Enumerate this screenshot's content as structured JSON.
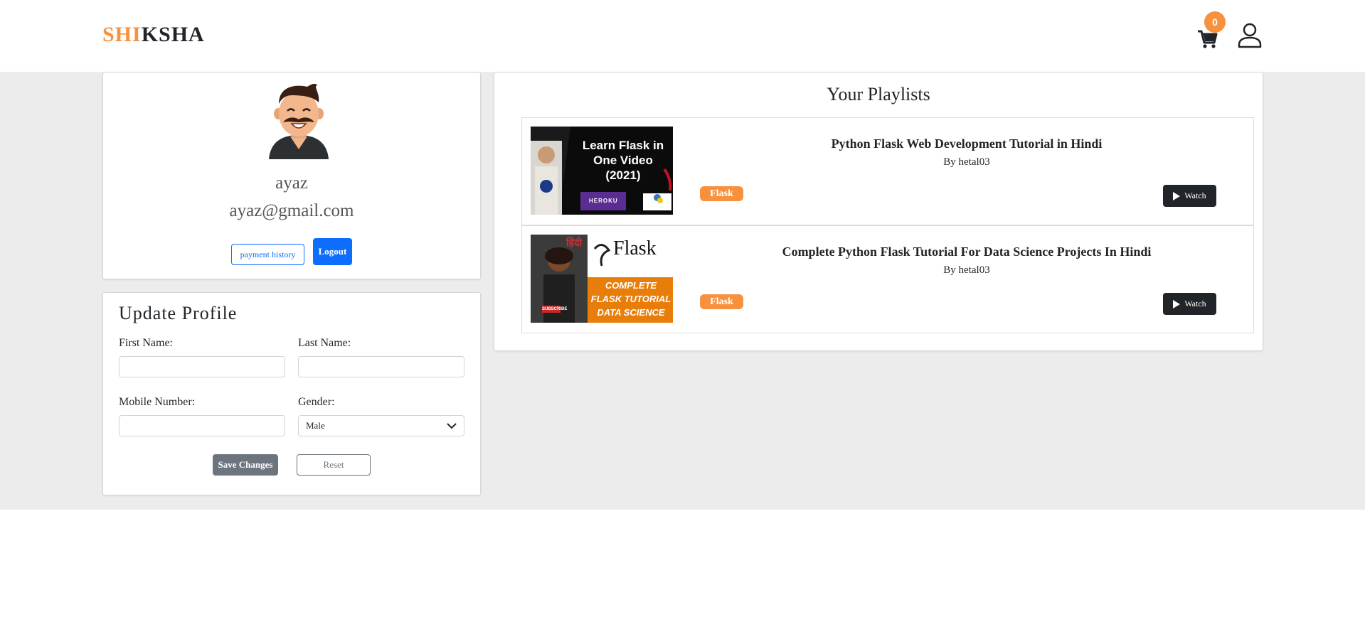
{
  "header": {
    "brand_accent": "SHI",
    "brand_rest": "KSHA",
    "cart_count": "0",
    "cart_icon": "cart-icon",
    "user_icon": "user-icon"
  },
  "profile": {
    "name": "ayaz",
    "email": "ayaz@gmail.com",
    "payment_history_label": "payment history",
    "logout_label": "Logout"
  },
  "update_profile": {
    "title": "Update Profile",
    "first_name_label": "First Name:",
    "first_name_value": "",
    "last_name_label": "Last Name:",
    "last_name_value": "",
    "mobile_label": "Mobile Number:",
    "mobile_value": "",
    "gender_label": "Gender:",
    "gender_value": "Male",
    "save_label": "Save Changes",
    "reset_label": "Reset"
  },
  "playlists": {
    "title": "Your Playlists",
    "items": [
      {
        "title": "Python Flask Web Development Tutorial in Hindi",
        "author": "By hetal03",
        "tag": "Flask",
        "watch_label": "Watch",
        "thumb_lines": [
          "Learn Flask in",
          "One Video",
          "(2021)"
        ],
        "thumb_badge": "HEROKU"
      },
      {
        "title": "Complete Python Flask Tutorial For Data Science Projects In Hindi",
        "author": "By hetal03",
        "tag": "Flask",
        "watch_label": "Watch",
        "thumb_lines": [
          "हिंदी",
          "Flask",
          "COMPLETE",
          "FLASK TUTORIAL",
          "DATA SCIENCE"
        ],
        "thumb_badge": "SUBSCRIBE"
      }
    ]
  },
  "colors": {
    "accent": "#f7913d",
    "primary": "#0d6efd",
    "dark": "#212529",
    "band": "#ececec"
  }
}
